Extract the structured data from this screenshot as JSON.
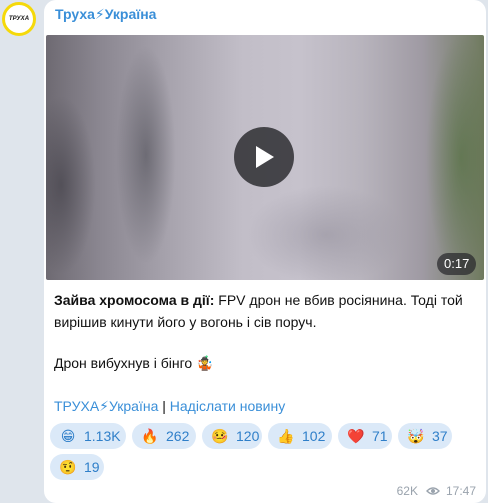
{
  "channel": {
    "name": "Труха⚡Україна",
    "avatar_text": "ТРУХА"
  },
  "video": {
    "duration": "0:17"
  },
  "post": {
    "caption_bold": "Зайва хромосома в дії:",
    "caption_rest": " FPV дрон не вбив росіянина. Тоді той вирішив кинути його у вогонь і сів поруч.",
    "caption_line2": "Дрон вибухнув і бінго",
    "caption_line2_emoji": "🤹"
  },
  "links": {
    "channel_link": "ТРУХА⚡Україна",
    "separator": "|",
    "submit_link": "Надіслати новину"
  },
  "reactions": [
    {
      "emoji": "😁",
      "count": "1.13K"
    },
    {
      "emoji": "🔥",
      "count": "262"
    },
    {
      "emoji": "🤒",
      "count": "120"
    },
    {
      "emoji": "👍",
      "count": "102"
    },
    {
      "emoji": "❤️",
      "count": "71"
    },
    {
      "emoji": "🤯",
      "count": "37"
    },
    {
      "emoji": "🤨",
      "count": "19"
    }
  ],
  "footer": {
    "views": "62K",
    "time": "17:47"
  },
  "colors": {
    "link": "#3a8fd8",
    "reaction_bg": "#dbe9f8",
    "avatar_ring": "#f5d90a"
  }
}
